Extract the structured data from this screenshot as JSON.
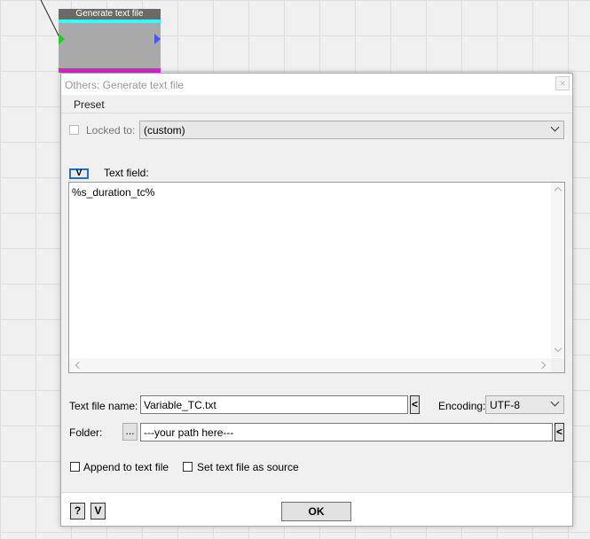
{
  "node": {
    "title": "Generate text file"
  },
  "dialog": {
    "title": "Others: Generate text file",
    "close_symbol": "×",
    "menu": {
      "preset": "Preset"
    },
    "locked_to": {
      "label": "Locked to:",
      "value": "(custom)"
    },
    "toggle_label": "V",
    "text_field": {
      "label": "Text field:",
      "value": "%s_duration_tc%"
    },
    "text_file_name": {
      "label": "Text file name:",
      "value": "Variable_TC.txt",
      "arrow_label": "<"
    },
    "encoding": {
      "label": "Encoding:",
      "value": "UTF-8"
    },
    "folder": {
      "label": "Folder:",
      "browse_label": "...",
      "value": "---your path here---",
      "arrow_label": "<"
    },
    "options": {
      "append_label": "Append to text file",
      "set_source_label": "Set text file as source"
    },
    "footer": {
      "help_label": "?",
      "v_label": "V",
      "ok_label": "OK"
    }
  },
  "colors": {
    "accent": "#1e72c4",
    "node_cyan": "#33ffff",
    "node_magenta": "#e020e0",
    "port_green": "#22cc22",
    "port_blue": "#4455ff"
  },
  "icons": [
    "close-icon",
    "chevron-down-icon",
    "arrow-left-icon",
    "scroll-up-icon",
    "scroll-down-icon",
    "scroll-left-icon",
    "scroll-right-icon"
  ]
}
